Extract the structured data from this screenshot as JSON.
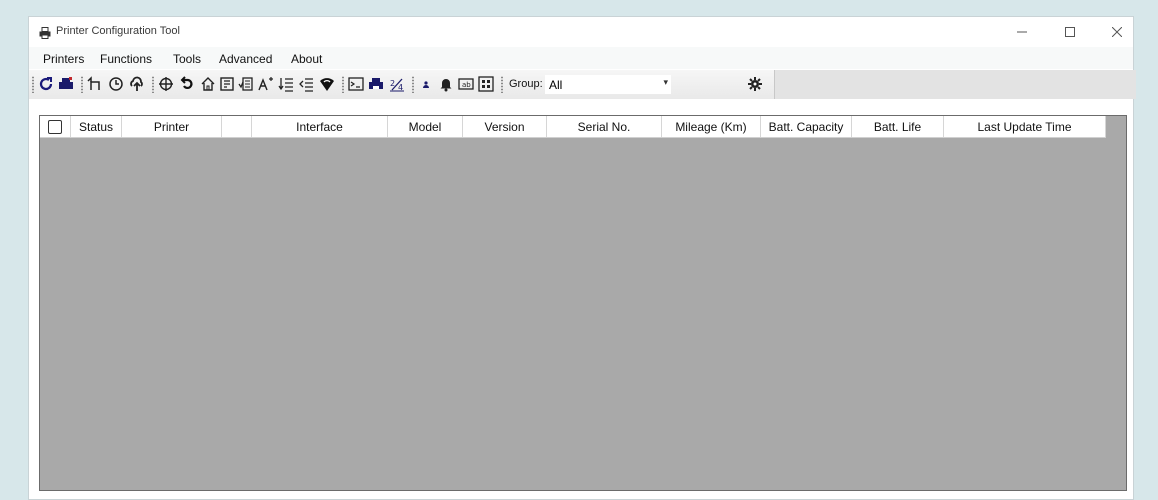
{
  "window": {
    "title": "Printer Configuration Tool"
  },
  "menu": [
    "Printers",
    "Functions",
    "Tools",
    "Advanced",
    "About"
  ],
  "toolbar": {
    "group_label": "Group:",
    "group_value": "All"
  },
  "table": {
    "columns": [
      "Status",
      "Printer",
      "",
      "Interface",
      "Model",
      "Version",
      "Serial No.",
      "Mileage (Km)",
      "Batt. Capacity",
      "Batt. Life",
      "Last Update Time"
    ],
    "rows": []
  },
  "colors": {
    "grid_background": "#a9a9a9",
    "window_background": "#ffffff",
    "desktop": "#d7e7ea"
  }
}
